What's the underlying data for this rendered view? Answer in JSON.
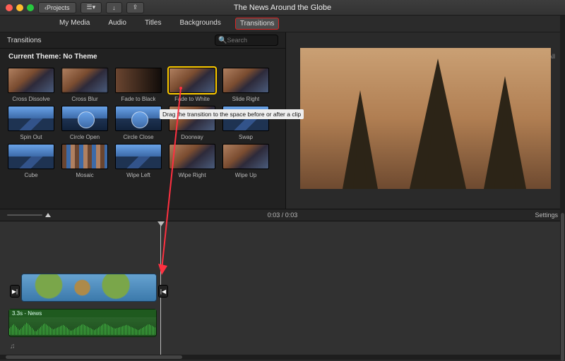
{
  "titlebar": {
    "projects_label": "Projects",
    "title": "The News Around the Globe"
  },
  "tabs": {
    "items": [
      "My Media",
      "Audio",
      "Titles",
      "Backgrounds",
      "Transitions"
    ],
    "active_index": 4
  },
  "browser": {
    "heading": "Transitions",
    "search_placeholder": "Search",
    "theme_label": "Current Theme:",
    "theme_value": "No Theme",
    "selected_index": 3,
    "tooltip": "Drag the transition to the space before or after a clip",
    "items": [
      {
        "label": "Cross Dissolve",
        "style": ""
      },
      {
        "label": "Cross Blur",
        "style": "blur"
      },
      {
        "label": "Fade to Black",
        "style": "fade"
      },
      {
        "label": "Fade to White",
        "style": ""
      },
      {
        "label": "Slide Right",
        "style": ""
      },
      {
        "label": "Spin Out",
        "style": "mtn"
      },
      {
        "label": "Circle Open",
        "style": "mtn circle"
      },
      {
        "label": "Circle Close",
        "style": "mtn circle"
      },
      {
        "label": "Doorway",
        "style": ""
      },
      {
        "label": "Swap",
        "style": "mtn"
      },
      {
        "label": "Cube",
        "style": "mtn"
      },
      {
        "label": "Mosaic",
        "style": "mosaic"
      },
      {
        "label": "Wipe Left",
        "style": "mtn"
      },
      {
        "label": "Wipe Right",
        "style": ""
      },
      {
        "label": "Wipe Up",
        "style": ""
      }
    ]
  },
  "preview": {
    "reset_label": "Reset All"
  },
  "midbar": {
    "current_time": "0:03",
    "total_time": "0:03",
    "settings_label": "Settings"
  },
  "timeline": {
    "audio_clip_label": "3.3s - News",
    "transition_glyph_left": "▶|",
    "transition_glyph_right": "|◀"
  }
}
